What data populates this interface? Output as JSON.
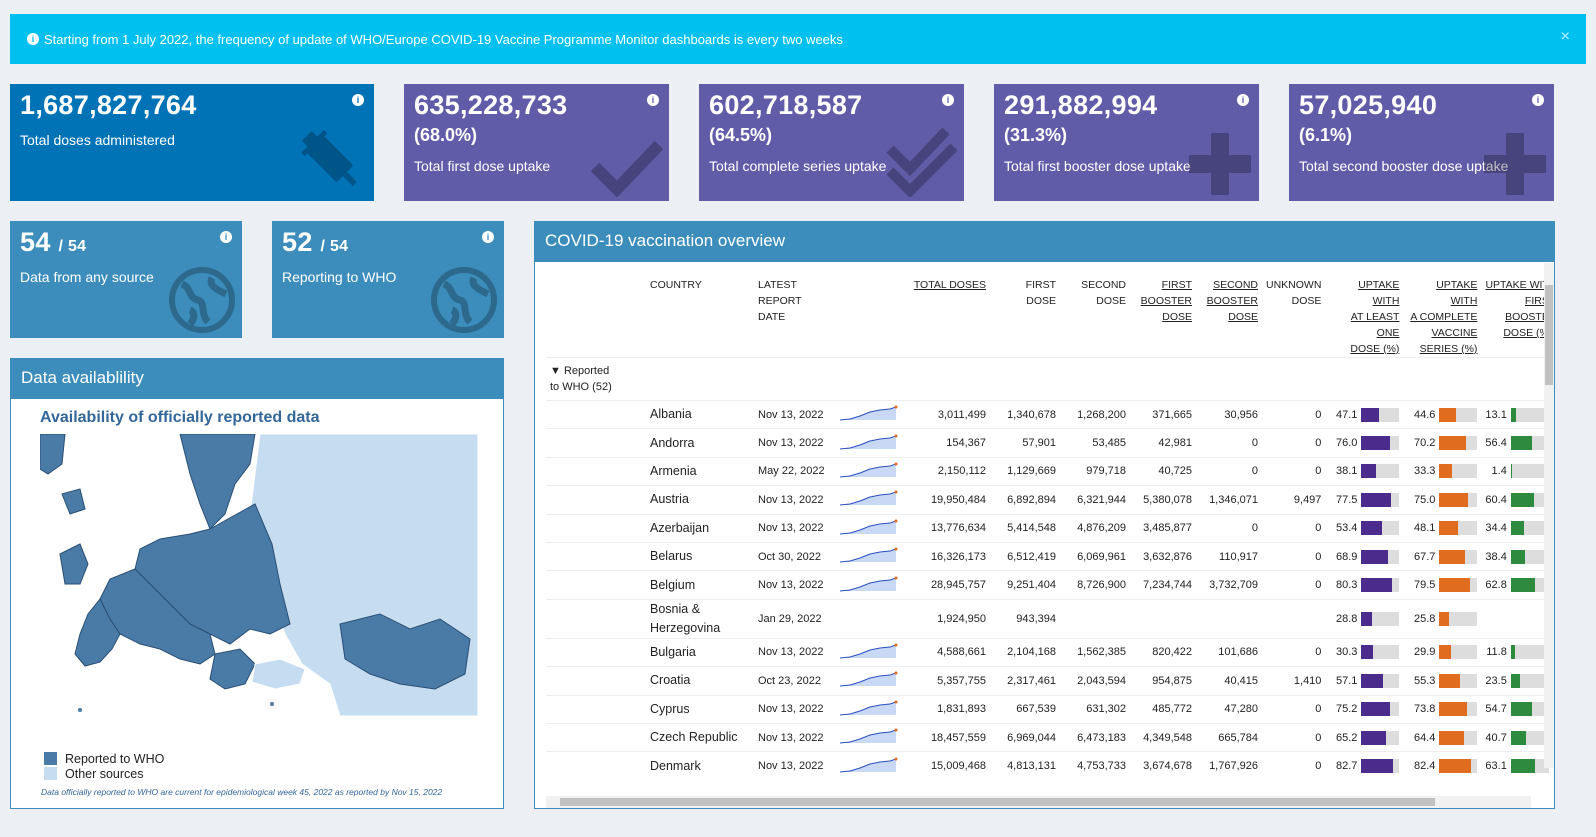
{
  "banner": {
    "text": "Starting from 1 July 2022, the frequency of update of WHO/Europe COVID-19 Vaccine Programme Monitor dashboards is every two weeks",
    "close": "×"
  },
  "kpis": [
    {
      "value": "1,687,827,764",
      "pct": "",
      "label": "Total doses administered"
    },
    {
      "value": "635,228,733",
      "pct": "(68.0%)",
      "label": "Total first dose uptake"
    },
    {
      "value": "602,718,587",
      "pct": "(64.5%)",
      "label": "Total complete series uptake"
    },
    {
      "value": "291,882,994",
      "pct": "(31.3%)",
      "label": "Total first booster dose uptake"
    },
    {
      "value": "57,025,940",
      "pct": "(6.1%)",
      "label": "Total second booster dose uptake"
    }
  ],
  "sources": [
    {
      "value": "54",
      "total": "/ 54",
      "label": "Data from any source"
    },
    {
      "value": "52",
      "total": "/ 54",
      "label": "Reporting to WHO"
    }
  ],
  "availability": {
    "title": "Data availablility",
    "map_title": "Availability of officially reported data",
    "legend_reported": "Reported to WHO",
    "legend_other": "Other sources",
    "note": "Data officially reported to WHO are current for epidemiological week 45, 2022 as reported by Nov 15, 2022",
    "reported_color": "#4a7ba7",
    "other_color": "#c6dcf1"
  },
  "overview": {
    "title": "COVID-19 vaccination overview",
    "headers": {
      "country": "COUNTRY",
      "report_a": "LATEST",
      "report_b": "REPORT DATE",
      "total": "TOTAL DOSES",
      "first": "FIRST DOSE",
      "second_a": "SECOND",
      "second_b": "DOSE",
      "fb_a": "FIRST",
      "fb_b": "BOOSTER",
      "fb_c": "DOSE",
      "sb_a": "SECOND",
      "sb_b": "BOOSTER",
      "sb_c": "DOSE",
      "unk_a": "UNKNOWN",
      "unk_b": "DOSE",
      "u1_a": "UPTAKE WITH",
      "u1_b": "AT LEAST ONE",
      "u1_c": "DOSE (%)",
      "u2_a": "UPTAKE WITH",
      "u2_b": "A COMPLETE",
      "u2_c": "VACCINE",
      "u2_d": "SERIES (%)",
      "u3_a": "UPTAKE WIT",
      "u3_b": "FIRS",
      "u3_c": "BOOSTE",
      "u3_d": "DOSE (%"
    },
    "group": {
      "a": "Reported",
      "b": "to WHO (52)"
    },
    "rows": [
      {
        "country": "Albania",
        "date": "Nov 13, 2022",
        "total": "3,011,499",
        "first": "1,340,678",
        "second": "1,268,200",
        "fb": "371,665",
        "sb": "30,956",
        "unk": "0",
        "u1": "47.1",
        "u2": "44.6",
        "u3": "13.1"
      },
      {
        "country": "Andorra",
        "date": "Nov 13, 2022",
        "total": "154,367",
        "first": "57,901",
        "second": "53,485",
        "fb": "42,981",
        "sb": "0",
        "unk": "0",
        "u1": "76.0",
        "u2": "70.2",
        "u3": "56.4"
      },
      {
        "country": "Armenia",
        "date": "May 22, 2022",
        "total": "2,150,112",
        "first": "1,129,669",
        "second": "979,718",
        "fb": "40,725",
        "sb": "0",
        "unk": "0",
        "u1": "38.1",
        "u2": "33.3",
        "u3": "1.4"
      },
      {
        "country": "Austria",
        "date": "Nov 13, 2022",
        "total": "19,950,484",
        "first": "6,892,894",
        "second": "6,321,944",
        "fb": "5,380,078",
        "sb": "1,346,071",
        "unk": "9,497",
        "u1": "77.5",
        "u2": "75.0",
        "u3": "60.4"
      },
      {
        "country": "Azerbaijan",
        "date": "Nov 13, 2022",
        "total": "13,776,634",
        "first": "5,414,548",
        "second": "4,876,209",
        "fb": "3,485,877",
        "sb": "0",
        "unk": "0",
        "u1": "53.4",
        "u2": "48.1",
        "u3": "34.4"
      },
      {
        "country": "Belarus",
        "date": "Oct 30, 2022",
        "total": "16,326,173",
        "first": "6,512,419",
        "second": "6,069,961",
        "fb": "3,632,876",
        "sb": "110,917",
        "unk": "0",
        "u1": "68.9",
        "u2": "67.7",
        "u3": "38.4"
      },
      {
        "country": "Belgium",
        "date": "Nov 13, 2022",
        "total": "28,945,757",
        "first": "9,251,404",
        "second": "8,726,900",
        "fb": "7,234,744",
        "sb": "3,732,709",
        "unk": "0",
        "u1": "80.3",
        "u2": "79.5",
        "u3": "62.8"
      },
      {
        "country": "Bosnia & Herzegovina",
        "date": "Jan 29, 2022",
        "total": "1,924,950",
        "first": "943,394",
        "second": "",
        "fb": "",
        "sb": "",
        "unk": "",
        "u1": "28.8",
        "u2": "25.8",
        "u3": ""
      },
      {
        "country": "Bulgaria",
        "date": "Nov 13, 2022",
        "total": "4,588,661",
        "first": "2,104,168",
        "second": "1,562,385",
        "fb": "820,422",
        "sb": "101,686",
        "unk": "0",
        "u1": "30.3",
        "u2": "29.9",
        "u3": "11.8"
      },
      {
        "country": "Croatia",
        "date": "Oct 23, 2022",
        "total": "5,357,755",
        "first": "2,317,461",
        "second": "2,043,594",
        "fb": "954,875",
        "sb": "40,415",
        "unk": "1,410",
        "u1": "57.1",
        "u2": "55.3",
        "u3": "23.5"
      },
      {
        "country": "Cyprus",
        "date": "Nov 13, 2022",
        "total": "1,831,893",
        "first": "667,539",
        "second": "631,302",
        "fb": "485,772",
        "sb": "47,280",
        "unk": "0",
        "u1": "75.2",
        "u2": "73.8",
        "u3": "54.7"
      },
      {
        "country": "Czech Republic",
        "date": "Nov 13, 2022",
        "total": "18,457,559",
        "first": "6,969,044",
        "second": "6,473,183",
        "fb": "4,349,548",
        "sb": "665,784",
        "unk": "0",
        "u1": "65.2",
        "u2": "64.4",
        "u3": "40.7"
      },
      {
        "country": "Denmark",
        "date": "Nov 13, 2022",
        "total": "15,009,468",
        "first": "4,813,131",
        "second": "4,753,733",
        "fb": "3,674,678",
        "sb": "1,767,926",
        "unk": "0",
        "u1": "82.7",
        "u2": "82.4",
        "u3": "63.1"
      }
    ]
  }
}
